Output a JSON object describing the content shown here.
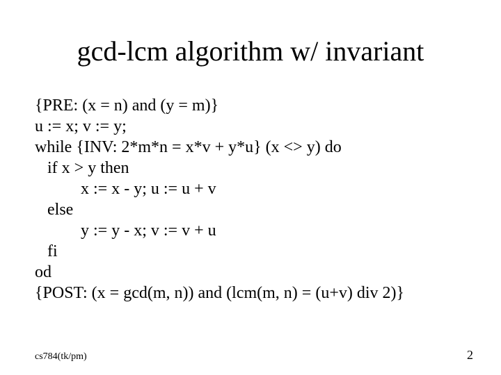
{
  "title": "gcd-lcm algorithm w/ invariant",
  "code": "{PRE: (x = n) and (y = m)}\nu := x; v := y;\nwhile {INV: 2*m*n = x*v + y*u} (x <> y) do\n   if x > y then\n           x := x - y; u := u + v\n   else\n           y := y - x; v := v + u\n   fi\nod\n{POST: (x = gcd(m, n)) and (lcm(m, n) = (u+v) div 2)}",
  "footer_left": "cs784(tk/pm)",
  "page_number": "2"
}
